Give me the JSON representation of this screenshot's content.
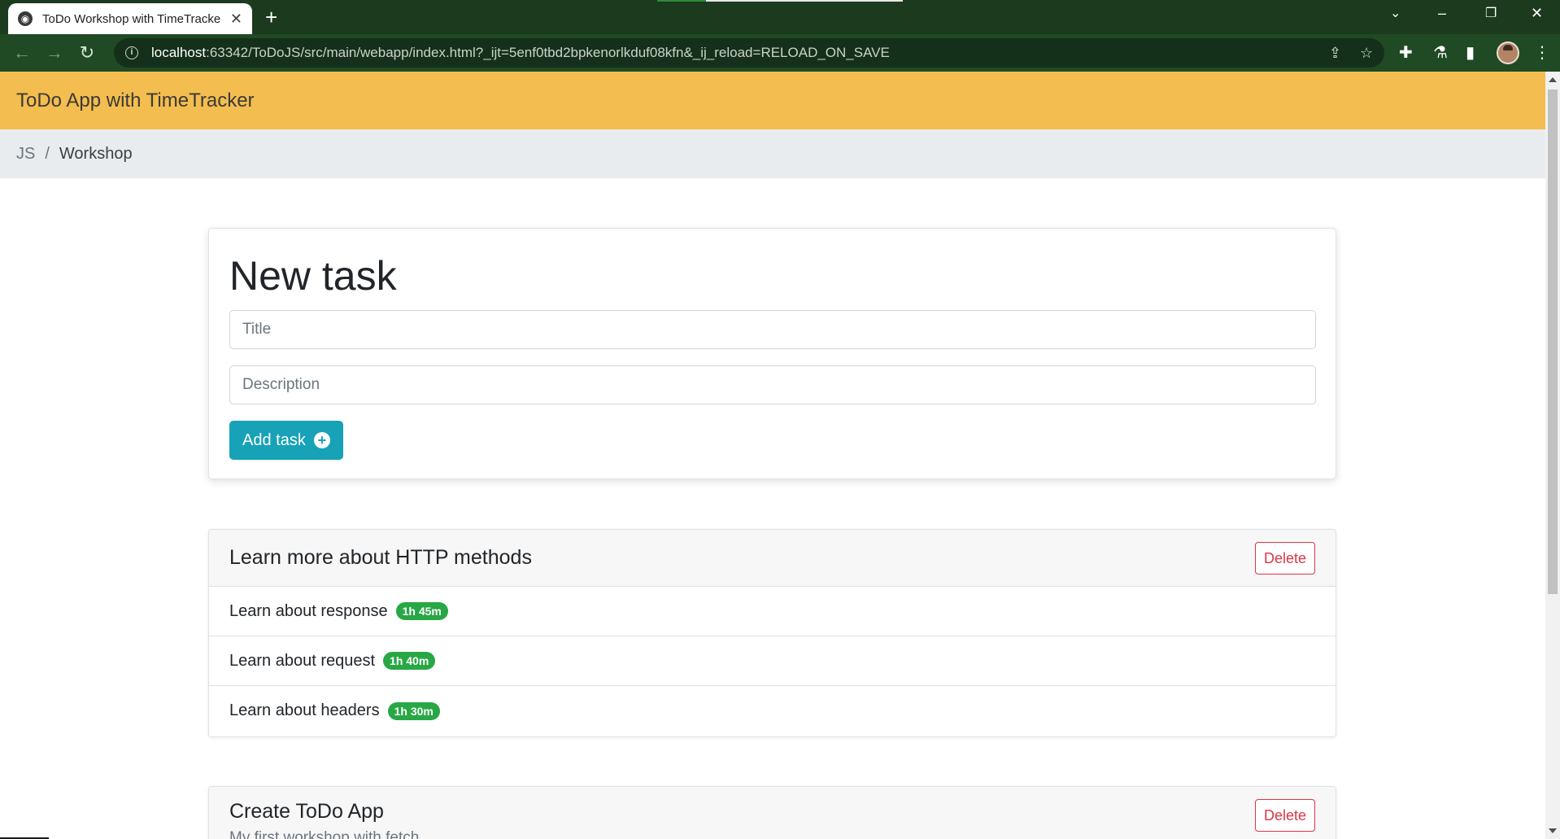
{
  "browser": {
    "tab_title": "ToDo Workshop with TimeTracker",
    "tab_close": "✕",
    "new_tab": "+",
    "url_host": "localhost",
    "url_rest": ":63342/ToDoJS/src/main/webapp/index.html?_ijt=5enf0tbd2bpkenorlkduf08kfn&_ij_reload=RELOAD_ON_SAVE",
    "icons": [
      "globe-icon",
      "close-icon",
      "plus-icon",
      "chevron-down-icon",
      "minimize-icon",
      "restore-icon",
      "window-close-icon",
      "back-icon",
      "forward-icon",
      "reload-icon",
      "info-icon",
      "share-icon",
      "star-icon",
      "puzzle-icon",
      "flask-icon",
      "sidepanel-icon",
      "avatar",
      "kebab-menu-icon"
    ]
  },
  "app": {
    "brand": "ToDo App with TimeTracker",
    "breadcrumb": {
      "link": "JS",
      "separator": "/",
      "active": "Workshop"
    }
  },
  "new_task": {
    "heading": "New task",
    "title_placeholder": "Title",
    "description_placeholder": "Description",
    "add_button_label": "Add task"
  },
  "tasks": [
    {
      "title": "Learn more about HTTP methods",
      "description": "",
      "delete_label": "Delete",
      "operations": [
        {
          "description": "Learn about response",
          "time": "1h 45m"
        },
        {
          "description": "Learn about request",
          "time": "1h 40m"
        },
        {
          "description": "Learn about headers",
          "time": "1h 30m"
        }
      ]
    },
    {
      "title": "Create ToDo App",
      "description": "My first workshop with fetch",
      "delete_label": "Delete",
      "operations": []
    }
  ],
  "colors": {
    "navbar": "#f3bd4f",
    "breadcrumb_bg": "#e9ecef",
    "primary_button": "#17a2b8",
    "danger": "#dc3545",
    "badge": "#28a745",
    "chrome_frame": "#1c3a1e",
    "chrome_toolbar": "#1f4a23"
  }
}
